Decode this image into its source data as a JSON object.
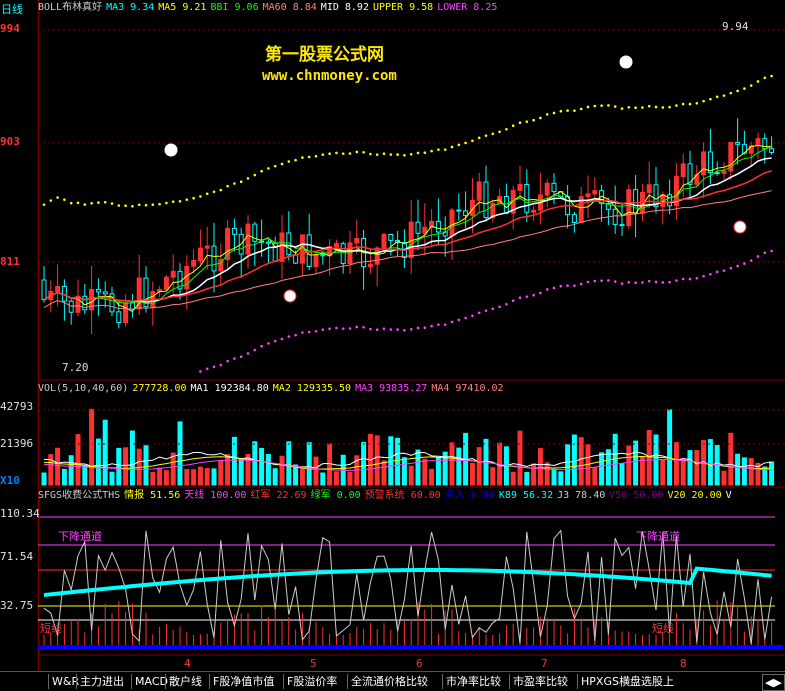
{
  "header": {
    "period": "日线",
    "indicator": "BOLL布林真好",
    "items": [
      {
        "label": "MA3",
        "value": "9.34",
        "color": "#00ffff"
      },
      {
        "label": "MA5",
        "value": "9.21",
        "color": "#ffff00"
      },
      {
        "label": "BBI",
        "value": "9.06",
        "color": "#00ff00"
      },
      {
        "label": "MA60",
        "value": "8.84",
        "color": "#ff8080"
      },
      {
        "label": "MID",
        "value": "8.92",
        "color": "#ffffff"
      },
      {
        "label": "UPPER",
        "value": "9.58",
        "color": "#ffff00"
      },
      {
        "label": "LOWER",
        "value": "8.25",
        "color": "#ff40ff"
      }
    ]
  },
  "watermark": {
    "title": "第一股票公式网",
    "url": "www.chnmoney.com"
  },
  "price_axis": {
    "ticks": [
      "994",
      "903",
      "811"
    ]
  },
  "price_annotations": {
    "high": "9.94",
    "low": "7.20"
  },
  "volume": {
    "legend_main": "VOL(5,10,40,60)",
    "items": [
      {
        "label": "",
        "value": "277728.00",
        "color": "#ffff00"
      },
      {
        "label": "MA1",
        "value": "192384.80",
        "color": "#ffffff"
      },
      {
        "label": "MA2",
        "value": "129335.50",
        "color": "#ffff00"
      },
      {
        "label": "MA3",
        "value": "93835.27",
        "color": "#ff40ff"
      },
      {
        "label": "MA4",
        "value": "97410.02",
        "color": "#ff8080"
      }
    ],
    "ticks": [
      "42793",
      "21396"
    ],
    "unit": "X10"
  },
  "sfgs": {
    "legend_main": "SFGS收费公式THS",
    "items": [
      {
        "label": "情报",
        "value": "51.56",
        "color": "#ffff00"
      },
      {
        "label": "天线",
        "value": "100.00",
        "color": "#ff40ff"
      },
      {
        "label": "红军",
        "value": "22.69",
        "color": "#ff3030"
      },
      {
        "label": "绿军",
        "value": "0.00",
        "color": "#00ff00"
      },
      {
        "label": "预警系统",
        "value": "60.00",
        "color": "#ff3030"
      },
      {
        "label": "买入",
        "value": "0.00",
        "color": "#0000ff"
      },
      {
        "label": "K89",
        "value": "56.32",
        "color": "#00ffff"
      },
      {
        "label": "J3",
        "value": "78.40",
        "color": "#cccccc"
      },
      {
        "label": "V50",
        "value": "50.00",
        "color": "#800080"
      },
      {
        "label": "V20",
        "value": "20.00",
        "color": "#ffff00"
      },
      {
        "label": "V",
        "value": "",
        "color": "#ffffff"
      }
    ],
    "ticks": [
      "110.34",
      "71.54",
      "32.75"
    ],
    "labels": {
      "down_channel_left": "下降通道",
      "down_channel_right": "下降通道",
      "shortline_left": "短线",
      "shortline_right": "短线"
    }
  },
  "x_axis": {
    "labels": [
      "4",
      "5",
      "6",
      "7",
      "8"
    ]
  },
  "tabs": [
    "W&R",
    "主力进出",
    "MACD",
    "散户线",
    "F股净值市值",
    "F股溢价率",
    "全流通价格比较",
    "市净率比较",
    "市盈率比较",
    "HPXGS横盘选股上"
  ]
}
